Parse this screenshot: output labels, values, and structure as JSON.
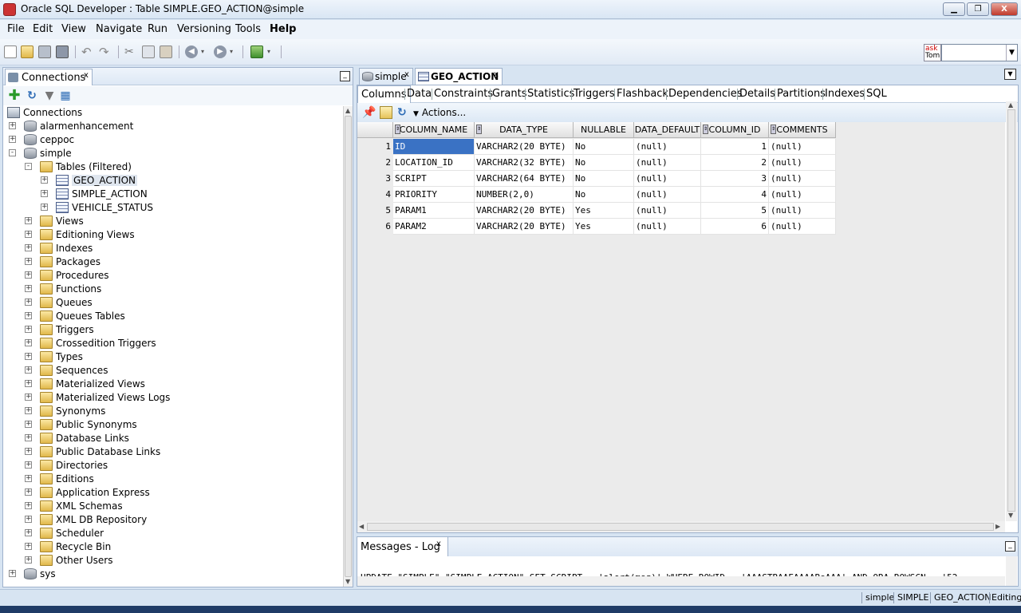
{
  "window": {
    "title": "Oracle SQL Developer : Table SIMPLE.GEO_ACTION@simple",
    "close_label": "X"
  },
  "menu": [
    {
      "label": "File"
    },
    {
      "label": "Edit"
    },
    {
      "label": "View"
    },
    {
      "label": "Navigate"
    },
    {
      "label": "Run"
    },
    {
      "label": "Versioning"
    },
    {
      "label": "Tools"
    },
    {
      "label": "Help"
    }
  ],
  "toolbar": {
    "asktom_label_top": "ask",
    "asktom_label_bottom": "Tom",
    "search_value": ""
  },
  "connections_panel": {
    "tab_label": "Connections",
    "tree": [
      {
        "label": "Connections",
        "level": 0,
        "icon": "connections-icon",
        "expander": ""
      },
      {
        "label": "alarmenhancement",
        "level": 1,
        "icon": "database-icon",
        "expander": "+"
      },
      {
        "label": "ceppoc",
        "level": 1,
        "icon": "database-icon",
        "expander": "+"
      },
      {
        "label": "simple",
        "level": 1,
        "icon": "database-icon",
        "expander": "-"
      },
      {
        "label": "Tables (Filtered)",
        "level": 2,
        "icon": "folder-icon",
        "expander": "-"
      },
      {
        "label": "GEO_ACTION",
        "level": 3,
        "icon": "table-icon",
        "expander": "+",
        "selected": true
      },
      {
        "label": "SIMPLE_ACTION",
        "level": 3,
        "icon": "table-icon",
        "expander": "+"
      },
      {
        "label": "VEHICLE_STATUS",
        "level": 3,
        "icon": "table-icon",
        "expander": "+"
      },
      {
        "label": "Views",
        "level": 2,
        "icon": "folder-icon",
        "expander": "+"
      },
      {
        "label": "Editioning Views",
        "level": 2,
        "icon": "folder-icon",
        "expander": "+"
      },
      {
        "label": "Indexes",
        "level": 2,
        "icon": "folder-icon",
        "expander": "+"
      },
      {
        "label": "Packages",
        "level": 2,
        "icon": "folder-icon",
        "expander": "+"
      },
      {
        "label": "Procedures",
        "level": 2,
        "icon": "folder-icon",
        "expander": "+"
      },
      {
        "label": "Functions",
        "level": 2,
        "icon": "folder-icon",
        "expander": "+"
      },
      {
        "label": "Queues",
        "level": 2,
        "icon": "folder-icon",
        "expander": "+"
      },
      {
        "label": "Queues Tables",
        "level": 2,
        "icon": "folder-icon",
        "expander": "+"
      },
      {
        "label": "Triggers",
        "level": 2,
        "icon": "folder-icon",
        "expander": "+"
      },
      {
        "label": "Crossedition Triggers",
        "level": 2,
        "icon": "folder-icon",
        "expander": "+"
      },
      {
        "label": "Types",
        "level": 2,
        "icon": "folder-icon",
        "expander": "+"
      },
      {
        "label": "Sequences",
        "level": 2,
        "icon": "folder-icon",
        "expander": "+"
      },
      {
        "label": "Materialized Views",
        "level": 2,
        "icon": "folder-icon",
        "expander": "+"
      },
      {
        "label": "Materialized Views Logs",
        "level": 2,
        "icon": "folder-icon",
        "expander": "+"
      },
      {
        "label": "Synonyms",
        "level": 2,
        "icon": "folder-icon",
        "expander": "+"
      },
      {
        "label": "Public Synonyms",
        "level": 2,
        "icon": "folder-icon",
        "expander": "+"
      },
      {
        "label": "Database Links",
        "level": 2,
        "icon": "folder-icon",
        "expander": "+"
      },
      {
        "label": "Public Database Links",
        "level": 2,
        "icon": "folder-icon",
        "expander": "+"
      },
      {
        "label": "Directories",
        "level": 2,
        "icon": "folder-icon",
        "expander": "+"
      },
      {
        "label": "Editions",
        "level": 2,
        "icon": "folder-icon",
        "expander": "+"
      },
      {
        "label": "Application Express",
        "level": 2,
        "icon": "folder-icon",
        "expander": "+"
      },
      {
        "label": "XML Schemas",
        "level": 2,
        "icon": "folder-icon",
        "expander": "+"
      },
      {
        "label": "XML DB Repository",
        "level": 2,
        "icon": "folder-icon",
        "expander": "+"
      },
      {
        "label": "Scheduler",
        "level": 2,
        "icon": "folder-icon",
        "expander": "+"
      },
      {
        "label": "Recycle Bin",
        "level": 2,
        "icon": "folder-icon",
        "expander": "+"
      },
      {
        "label": "Other Users",
        "level": 2,
        "icon": "folder-icon",
        "expander": "+"
      },
      {
        "label": "sys",
        "level": 1,
        "icon": "database-icon",
        "expander": "+"
      }
    ]
  },
  "editor": {
    "tabs": [
      {
        "label": "simple",
        "active": false
      },
      {
        "label": "GEO_ACTION",
        "active": true
      }
    ],
    "subtabs": [
      "Columns",
      "Data",
      "Constraints",
      "Grants",
      "Statistics",
      "Triggers",
      "Flashback",
      "Dependencies",
      "Details",
      "Partitions",
      "Indexes",
      "SQL"
    ],
    "active_subtab": "Columns",
    "actions_label": "Actions...",
    "columns": [
      "COLUMN_NAME",
      "DATA_TYPE",
      "NULLABLE",
      "DATA_DEFAULT",
      "COLUMN_ID",
      "COMMENTS"
    ],
    "rows": [
      {
        "n": "1",
        "cells": [
          "ID",
          "VARCHAR2(20 BYTE)",
          "No",
          "(null)",
          "1",
          "(null)"
        ]
      },
      {
        "n": "2",
        "cells": [
          "LOCATION_ID",
          "VARCHAR2(32 BYTE)",
          "No",
          "(null)",
          "2",
          "(null)"
        ]
      },
      {
        "n": "3",
        "cells": [
          "SCRIPT",
          "VARCHAR2(64 BYTE)",
          "No",
          "(null)",
          "3",
          "(null)"
        ]
      },
      {
        "n": "4",
        "cells": [
          "PRIORITY",
          "NUMBER(2,0)",
          "No",
          "(null)",
          "4",
          "(null)"
        ]
      },
      {
        "n": "5",
        "cells": [
          "PARAM1",
          "VARCHAR2(20 BYTE)",
          "Yes",
          "(null)",
          "5",
          "(null)"
        ]
      },
      {
        "n": "6",
        "cells": [
          "PARAM2",
          "VARCHAR2(20 BYTE)",
          "Yes",
          "(null)",
          "6",
          "(null)"
        ]
      }
    ]
  },
  "messages": {
    "tab_label": "Messages - Log",
    "text": "UPDATE \"SIMPLE\".\"SIMPLE_ACTION\" SET SCRIPT = 'alert(msg)' WHERE ROWID = 'AAASTBAAEAAAABsAAA' AND ORA_ROWSCN = '52"
  },
  "statusbar": {
    "items": [
      "simple",
      "SIMPLE",
      "GEO_ACTION",
      "Editing"
    ]
  },
  "colors": {
    "selection": "#3a72c4",
    "chrome": "#d7e4f2"
  }
}
